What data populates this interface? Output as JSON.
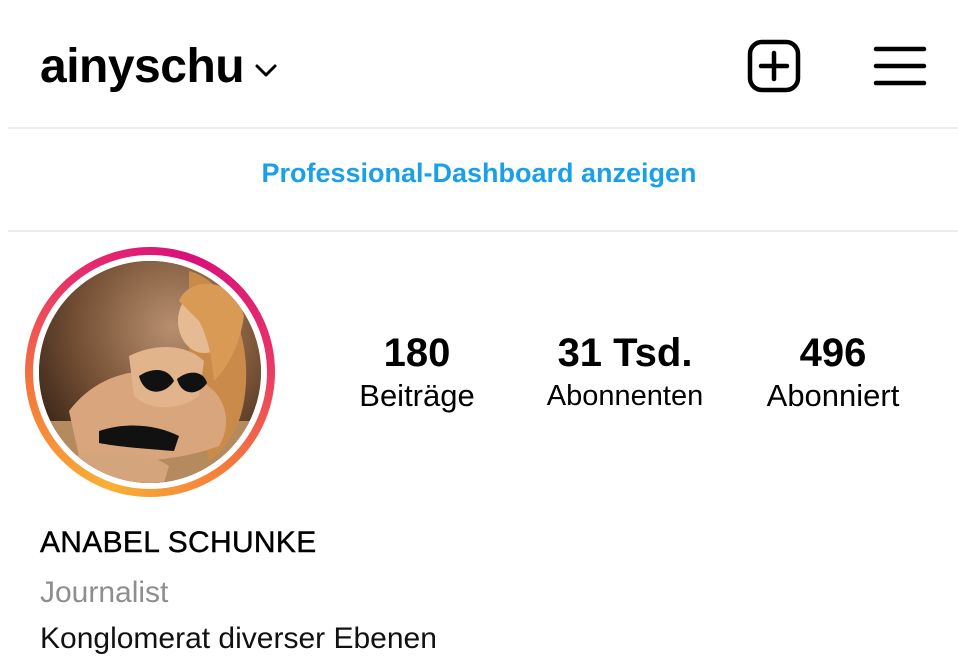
{
  "header": {
    "username": "ainyschu",
    "icons": {
      "switch_account": "chevron-down-icon",
      "new_post": "plus-square-icon",
      "menu": "hamburger-menu-icon"
    }
  },
  "dashboard_link": {
    "label": "Professional-Dashboard anzeigen",
    "color": "#1aa0e8"
  },
  "profile": {
    "avatar": "profile-photo",
    "story_ring_colors": [
      "#f9b035",
      "#f47a3c",
      "#e8306a",
      "#d8107a"
    ],
    "stats": [
      {
        "value": "180",
        "label": "Beiträge"
      },
      {
        "value": "31 Tsd.",
        "label": "Abonnenten"
      },
      {
        "value": "496",
        "label": "Abonniert"
      }
    ],
    "name": "ANABEL SCHUNKE",
    "category": "Journalist",
    "bio": "Konglomerat diverser Ebenen"
  }
}
